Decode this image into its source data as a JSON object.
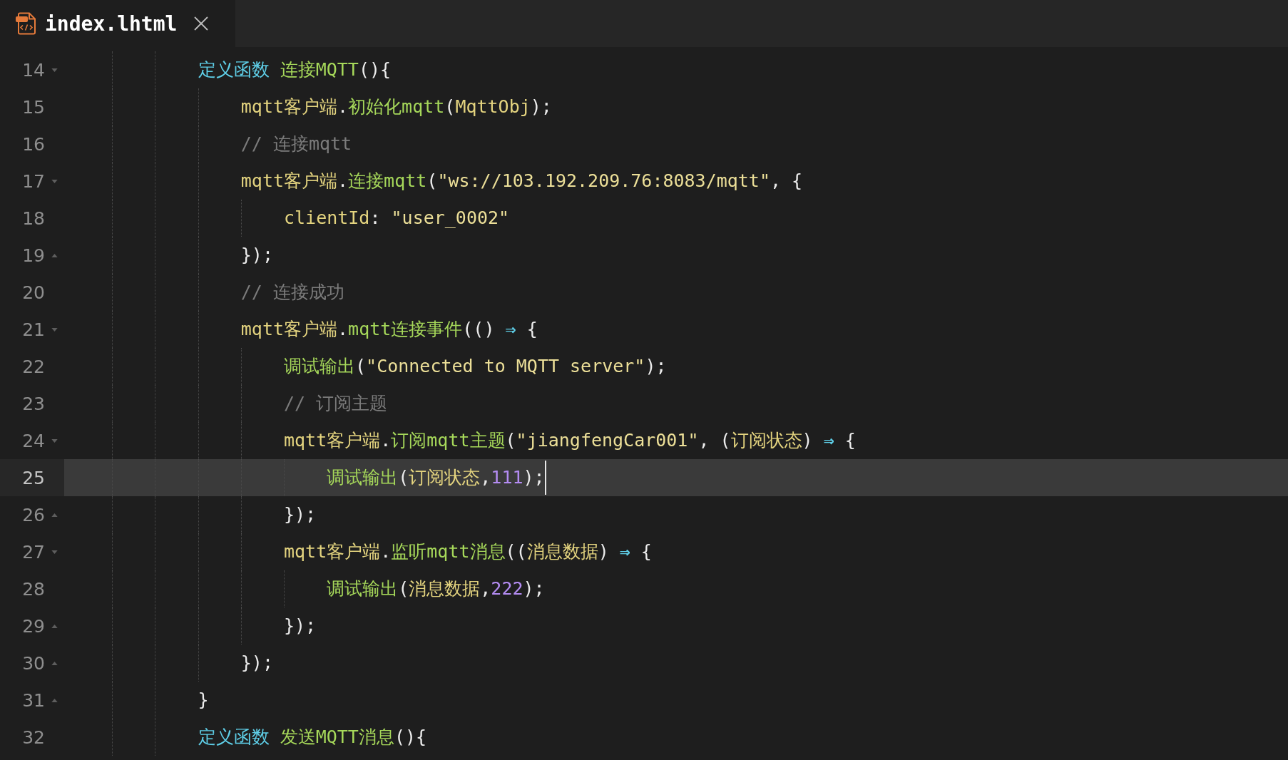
{
  "tabs": [
    {
      "title": "index.lhtml",
      "selected": true
    }
  ],
  "editor": {
    "lines": [
      {
        "number": "14",
        "fold_start": true,
        "fold_end": false,
        "current": false,
        "tokens": [
          {
            "kind": "keyword",
            "text": "定义函数"
          },
          {
            "kind": "function",
            "text": " 连接MQTT"
          },
          {
            "kind": "punct",
            "text": "(){"
          }
        ],
        "children": [
          {
            "number": "15",
            "fold_start": false,
            "fold_end": false,
            "current": false,
            "tokens": [
              {
                "kind": "ident",
                "text": "mqtt客户端"
              },
              {
                "kind": "punct",
                "text": "."
              },
              {
                "kind": "function",
                "text": "初始化mqtt"
              },
              {
                "kind": "punct",
                "text": "("
              },
              {
                "kind": "ident",
                "text": "MqttObj"
              },
              {
                "kind": "punct",
                "text": ");"
              }
            ]
          },
          {
            "number": "16",
            "fold_start": false,
            "fold_end": false,
            "current": false,
            "tokens": [
              {
                "kind": "comment",
                "text": "// 连接mqtt"
              }
            ]
          },
          {
            "number": "17",
            "fold_start": true,
            "fold_end": false,
            "current": false,
            "tokens": [
              {
                "kind": "ident",
                "text": "mqtt客户端"
              },
              {
                "kind": "punct",
                "text": "."
              },
              {
                "kind": "function",
                "text": "连接mqtt"
              },
              {
                "kind": "punct",
                "text": "("
              },
              {
                "kind": "string",
                "text": "\"ws://103.192.209.76:8083/mqtt\""
              },
              {
                "kind": "punct",
                "text": ", {"
              }
            ],
            "children": [
              {
                "number": "18",
                "fold_start": false,
                "fold_end": false,
                "current": false,
                "tokens": [
                  {
                    "kind": "ident",
                    "text": "clientId"
                  },
                  {
                    "kind": "punct",
                    "text": ": "
                  },
                  {
                    "kind": "string",
                    "text": "\"user_0002\""
                  }
                ]
              }
            ]
          },
          {
            "number": "19",
            "fold_start": false,
            "fold_end": true,
            "current": false,
            "tokens": [
              {
                "kind": "punct",
                "text": "});"
              }
            ]
          },
          {
            "number": "20",
            "fold_start": false,
            "fold_end": false,
            "current": false,
            "tokens": [
              {
                "kind": "comment",
                "text": "// 连接成功"
              }
            ]
          },
          {
            "number": "21",
            "fold_start": true,
            "fold_end": false,
            "current": false,
            "tokens": [
              {
                "kind": "ident",
                "text": "mqtt客户端"
              },
              {
                "kind": "punct",
                "text": "."
              },
              {
                "kind": "function",
                "text": "mqtt连接事件"
              },
              {
                "kind": "punct",
                "text": "(() "
              },
              {
                "kind": "arrow",
                "text": "⇒"
              },
              {
                "kind": "punct",
                "text": " {"
              }
            ],
            "children": [
              {
                "number": "22",
                "fold_start": false,
                "fold_end": false,
                "current": false,
                "tokens": [
                  {
                    "kind": "function",
                    "text": "调试输出"
                  },
                  {
                    "kind": "punct",
                    "text": "("
                  },
                  {
                    "kind": "string",
                    "text": "\"Connected to MQTT server\""
                  },
                  {
                    "kind": "punct",
                    "text": ");"
                  }
                ]
              },
              {
                "number": "23",
                "fold_start": false,
                "fold_end": false,
                "current": false,
                "tokens": [
                  {
                    "kind": "comment",
                    "text": "// 订阅主题"
                  }
                ]
              },
              {
                "number": "24",
                "fold_start": true,
                "fold_end": false,
                "current": false,
                "tokens": [
                  {
                    "kind": "ident",
                    "text": "mqtt客户端"
                  },
                  {
                    "kind": "punct",
                    "text": "."
                  },
                  {
                    "kind": "function",
                    "text": "订阅mqtt主题"
                  },
                  {
                    "kind": "punct",
                    "text": "("
                  },
                  {
                    "kind": "string",
                    "text": "\"jiangfengCar001\""
                  },
                  {
                    "kind": "punct",
                    "text": ", ("
                  },
                  {
                    "kind": "ident",
                    "text": "订阅状态"
                  },
                  {
                    "kind": "punct",
                    "text": ") "
                  },
                  {
                    "kind": "arrow",
                    "text": "⇒"
                  },
                  {
                    "kind": "punct",
                    "text": " {"
                  }
                ],
                "children": [
                  {
                    "number": "25",
                    "fold_start": false,
                    "fold_end": false,
                    "current": true,
                    "tokens": [
                      {
                        "kind": "function",
                        "text": "调试输出"
                      },
                      {
                        "kind": "punct",
                        "text": "("
                      },
                      {
                        "kind": "ident",
                        "text": "订阅状态"
                      },
                      {
                        "kind": "punct",
                        "text": ","
                      },
                      {
                        "kind": "number",
                        "text": "111"
                      },
                      {
                        "kind": "punct",
                        "text": ");"
                      }
                    ]
                  }
                ]
              },
              {
                "number": "26",
                "fold_start": false,
                "fold_end": true,
                "current": false,
                "tokens": [
                  {
                    "kind": "punct",
                    "text": "});"
                  }
                ]
              },
              {
                "number": "27",
                "fold_start": true,
                "fold_end": false,
                "current": false,
                "tokens": [
                  {
                    "kind": "ident",
                    "text": "mqtt客户端"
                  },
                  {
                    "kind": "punct",
                    "text": "."
                  },
                  {
                    "kind": "function",
                    "text": "监听mqtt消息"
                  },
                  {
                    "kind": "punct",
                    "text": "(("
                  },
                  {
                    "kind": "ident",
                    "text": "消息数据"
                  },
                  {
                    "kind": "punct",
                    "text": ") "
                  },
                  {
                    "kind": "arrow",
                    "text": "⇒"
                  },
                  {
                    "kind": "punct",
                    "text": " {"
                  }
                ],
                "children": [
                  {
                    "number": "28",
                    "fold_start": false,
                    "fold_end": false,
                    "current": false,
                    "tokens": [
                      {
                        "kind": "function",
                        "text": "调试输出"
                      },
                      {
                        "kind": "punct",
                        "text": "("
                      },
                      {
                        "kind": "ident",
                        "text": "消息数据"
                      },
                      {
                        "kind": "punct",
                        "text": ","
                      },
                      {
                        "kind": "number",
                        "text": "222"
                      },
                      {
                        "kind": "punct",
                        "text": ");"
                      }
                    ]
                  }
                ]
              },
              {
                "number": "29",
                "fold_start": false,
                "fold_end": true,
                "current": false,
                "tokens": [
                  {
                    "kind": "punct",
                    "text": "});"
                  }
                ]
              }
            ]
          },
          {
            "number": "30",
            "fold_start": false,
            "fold_end": true,
            "current": false,
            "tokens": [
              {
                "kind": "punct",
                "text": "});"
              }
            ]
          }
        ]
      },
      {
        "number": "31",
        "fold_start": false,
        "fold_end": true,
        "current": false,
        "tokens": [
          {
            "kind": "punct",
            "text": "}"
          }
        ]
      },
      {
        "number": "32",
        "fold_start": false,
        "fold_end": false,
        "current": false,
        "tokens": [
          {
            "kind": "keyword",
            "text": "定义函数"
          },
          {
            "kind": "function",
            "text": " 发送MQTT消息"
          },
          {
            "kind": "punct",
            "text": "(){"
          }
        ]
      }
    ]
  }
}
